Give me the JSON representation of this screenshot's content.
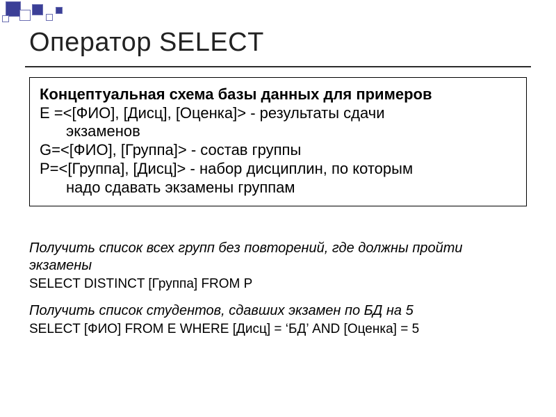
{
  "title": "Оператор SELECT",
  "schema": {
    "heading": "Концептуальная схема базы данных для примеров",
    "e_line1": "E =<[ФИО], [Дисц], [Оценка]> - результаты сдачи",
    "e_line2": "экзаменов",
    "g_line": "G=<[ФИО], [Группа]> - состав группы",
    "p_line1": "P=<[Группа], [Дисц]> - набор дисциплин, по которым",
    "p_line2": "надо сдавать экзамены группам"
  },
  "tasks": {
    "t1": "Получить список всех групп без повторений, где должны пройти экзамены",
    "q1": "SELECT DISTINCT [Группа] FROM P",
    "t2": "Получить список студентов, сдавших экзамен по БД на 5",
    "q2": "SELECT [ФИО] FROM E WHERE [Дисц] = ‘БД’ AND [Оценка] = 5"
  }
}
